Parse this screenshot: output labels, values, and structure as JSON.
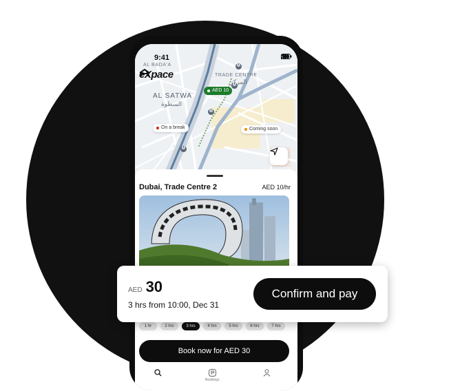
{
  "status": {
    "time": "9:41"
  },
  "brand": {
    "name": "eXpace"
  },
  "map": {
    "labels": {
      "al_bada": "AL BADA'A",
      "trade_centre": "TRADE CENTRE",
      "trade_centre_ar": "المركز",
      "al_satwa": "AL SATWA",
      "al_satwa_ar": "السطوة"
    },
    "metro_glyph": "M",
    "pins": {
      "active_price": "AED 10",
      "on_break": "On a break",
      "coming_soon": "Coming soon"
    },
    "colors": {
      "active": "#1c7c2a",
      "on_break": "#d0281e",
      "coming_soon": "#f08c00"
    }
  },
  "sheet": {
    "title": "Dubai, Trade Centre 2",
    "price": "AED 10/hr",
    "hour_options": [
      "1 hr",
      "2 hrs",
      "3 hrs",
      "4 hrs",
      "5 hrs",
      "6 hrs",
      "7 hrs"
    ],
    "selected_hours": "3 hrs",
    "book_label": "Book now for AED 30"
  },
  "tabbar": {
    "tabs": [
      {
        "icon": "search-icon",
        "label": ""
      },
      {
        "icon": "parking-icon",
        "label": "Bookings"
      },
      {
        "icon": "profile-icon",
        "label": ""
      }
    ]
  },
  "confirm": {
    "currency": "AED",
    "amount": "30",
    "summary": "3 hrs from 10:00, Dec 31",
    "button_label": "Confirm and pay"
  }
}
